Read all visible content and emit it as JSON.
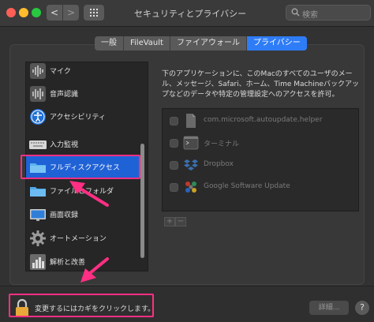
{
  "window": {
    "title": "セキュリティとプライバシー",
    "search_placeholder": "検索",
    "nav_back": "<",
    "nav_forward": ">"
  },
  "tabs": [
    {
      "label": "一般"
    },
    {
      "label": "FileVault"
    },
    {
      "label": "ファイアウォール"
    },
    {
      "label": "プライバシー",
      "active": true
    }
  ],
  "sidebar": {
    "items": [
      {
        "label": "マイク",
        "icon": "microphone-icon"
      },
      {
        "label": "音声認識",
        "icon": "speech-recognition-icon"
      },
      {
        "label": "アクセシビリティ",
        "icon": "accessibility-icon"
      },
      {
        "label": "入力監視",
        "icon": "keyboard-icon"
      },
      {
        "label": "フルディスクアクセス",
        "icon": "folder-icon",
        "selected": true
      },
      {
        "label": "ファイルとフォルダ",
        "icon": "folder-icon"
      },
      {
        "label": "画面収録",
        "icon": "display-icon"
      },
      {
        "label": "オートメーション",
        "icon": "gear-icon"
      },
      {
        "label": "解析と改善",
        "icon": "analytics-icon"
      }
    ]
  },
  "main": {
    "description": "下のアプリケーションに、このMacのすべてのユーザのメール、メッセージ、Safari、ホーム、Time Machineバックアップなどのデータや特定の管理設定へのアクセスを許可。",
    "apps": [
      {
        "name": "com.microsoft.autoupdate.helper",
        "icon": "document-icon",
        "checked": false
      },
      {
        "name": "ターミナル",
        "icon": "terminal-icon",
        "checked": false
      },
      {
        "name": "Dropbox",
        "icon": "dropbox-icon",
        "checked": false
      },
      {
        "name": "Google Software Update",
        "icon": "google-update-icon",
        "checked": false
      }
    ],
    "add_label": "+",
    "remove_label": "−"
  },
  "footer": {
    "lock_text": "変更するにはカギをクリックします。",
    "details_label": "詳細...",
    "help_label": "?"
  },
  "colors": {
    "accent": "#2e7cf6",
    "selection": "#1f62d6",
    "annotation": "#ff2f83"
  }
}
